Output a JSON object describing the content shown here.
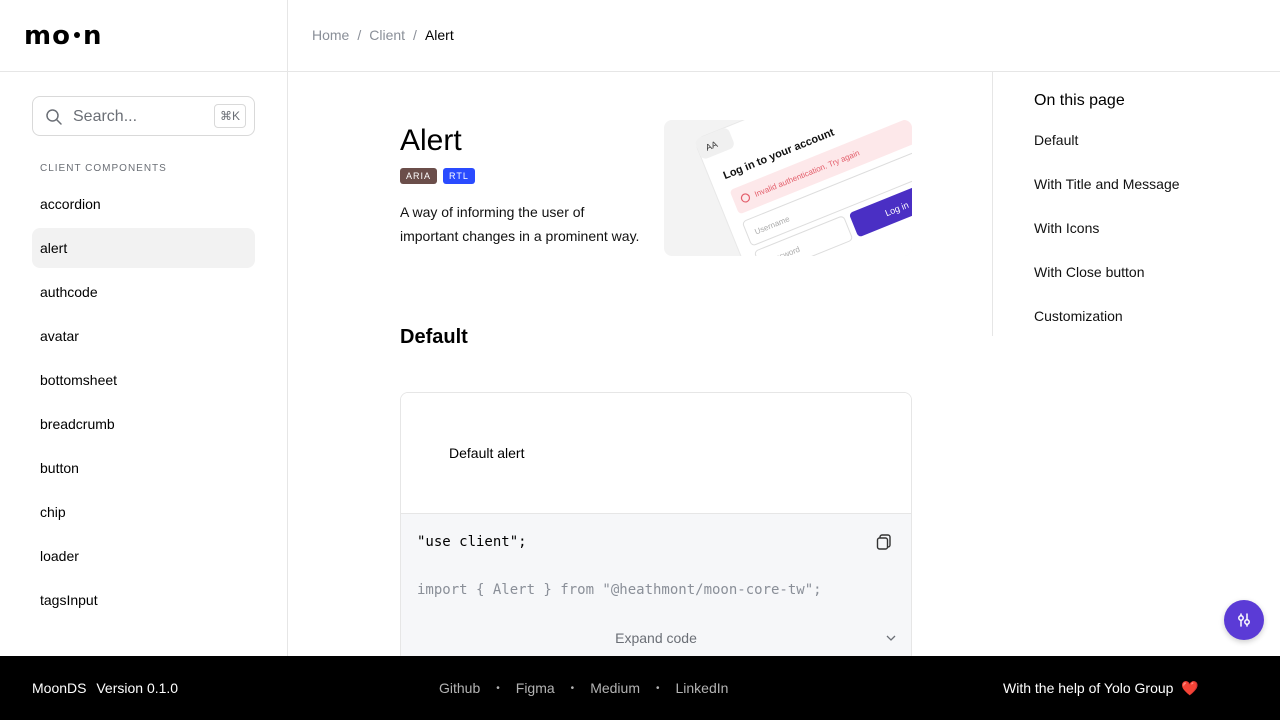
{
  "brand": {
    "logo_left": "mo",
    "logo_right": "n"
  },
  "breadcrumb": {
    "items": [
      "Home",
      "Client"
    ],
    "current": "Alert"
  },
  "sidebar": {
    "search_placeholder": "Search...",
    "shortcut": "⌘K",
    "heading": "CLIENT COMPONENTS",
    "items": [
      {
        "label": "accordion"
      },
      {
        "label": "alert"
      },
      {
        "label": "authcode"
      },
      {
        "label": "avatar"
      },
      {
        "label": "bottomsheet"
      },
      {
        "label": "breadcrumb"
      },
      {
        "label": "button"
      },
      {
        "label": "chip"
      },
      {
        "label": "loader"
      },
      {
        "label": "tagsInput"
      }
    ],
    "active": "alert"
  },
  "main": {
    "title": "Alert",
    "badges": [
      "ARIA",
      "RTL"
    ],
    "description": "A way of informing the user of important changes in a prominent way.",
    "preview": {
      "font_size_label": "AA",
      "heading": "Log in to your account",
      "error": "Invalid authentication. Try again",
      "username_placeholder": "Username",
      "password_placeholder": "Password",
      "button": "Log in"
    },
    "section_title": "Default",
    "demo": {
      "alert_text": "Default alert",
      "code_line1": "\"use client\";",
      "code_line2": "import { Alert } from \"@heathmont/moon-core-tw\";",
      "expand_label": "Expand code"
    }
  },
  "toc": {
    "title": "On this page",
    "items": [
      "Default",
      "With Title and Message",
      "With Icons",
      "With Close button",
      "Customization"
    ]
  },
  "footer": {
    "brand": "MoonDS",
    "version_label": "Version",
    "version": "0.1.0",
    "links": [
      "Github",
      "Figma",
      "Medium",
      "LinkedIn"
    ],
    "help_prefix": "With the help of",
    "help_name": "Yolo Group",
    "heart": "❤️"
  },
  "colors": {
    "accent": "#5b3bd6",
    "badge_aria": "#6b4e4a",
    "badge_rtl": "#2a4bff",
    "error": "#e35d6a"
  }
}
